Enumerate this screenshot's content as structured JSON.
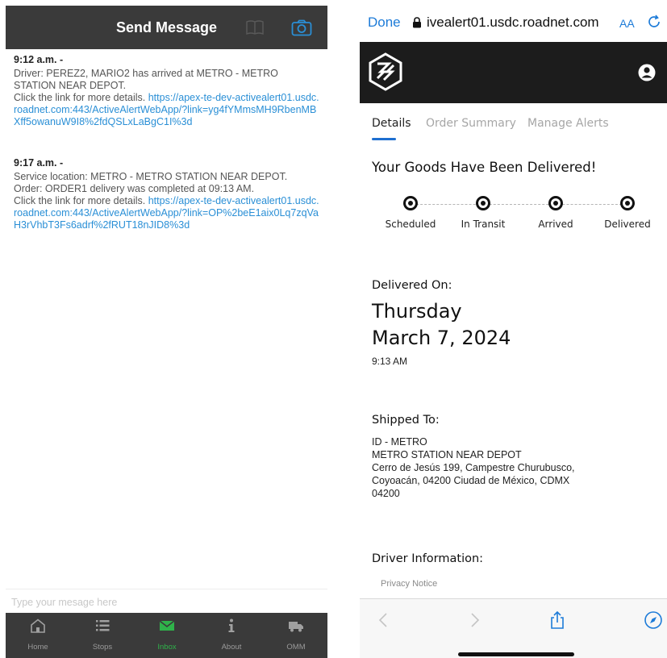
{
  "left_app": {
    "header": {
      "title": "Send Message",
      "book_icon": "book-icon",
      "camera_icon": "camera-icon"
    },
    "messages": [
      {
        "time": "9:12 a.m. -",
        "lines": [
          "Driver: PEREZ2, MARIO2   has arrived at METRO - METRO STATION NEAR DEPOT.",
          "Click the link for more details. "
        ],
        "link": "https://apex-te-dev-activealert01.usdc.roadnet.com:443/ActiveAlertWebApp/?link=yg4fYMmsMH9RbenMBXff5owanuW9I8%2fdQSLxLaBgC1I%3d"
      },
      {
        "time": "9:17 a.m. -",
        "lines": [
          "Service location: METRO - METRO STATION NEAR DEPOT.",
          "Order: ORDER1 delivery was completed at 09:13 AM.",
          "Click the link for more details. "
        ],
        "link": "https://apex-te-dev-activealert01.usdc.roadnet.com:443/ActiveAlertWebApp/?link=OP%2beE1aix0Lq7zqVaH3rVhbT3Fs6adrf%2fRUT18nJID8%3d"
      }
    ],
    "composer": {
      "placeholder": "Type your mesage here",
      "value": ""
    },
    "tabbar": [
      {
        "label": "Home",
        "icon": "home-icon",
        "active": false
      },
      {
        "label": "Stops",
        "icon": "list-icon",
        "active": false
      },
      {
        "label": "Inbox",
        "icon": "inbox-icon",
        "active": true
      },
      {
        "label": "About",
        "icon": "info-icon",
        "active": false
      },
      {
        "label": "OMM",
        "icon": "truck-icon",
        "active": false
      }
    ]
  },
  "right_app": {
    "browser": {
      "done_label": "Done",
      "url": "ivealert01.usdc.roadnet.com",
      "text_size_label": "AA",
      "lock_icon": "lock-icon",
      "reload_icon": "reload-icon"
    },
    "appbar": {
      "logo_icon": "logo-icon",
      "account_icon": "account-icon"
    },
    "tabs": [
      {
        "label": "Details",
        "active": true
      },
      {
        "label": "Order Summary",
        "active": false
      },
      {
        "label": "Manage Alerts",
        "active": false
      }
    ],
    "heading": "Your Goods Have Been Delivered!",
    "steps": [
      "Scheduled",
      "In Transit",
      "Arrived",
      "Delivered"
    ],
    "delivered_on": {
      "label": "Delivered On:",
      "day": "Thursday",
      "date": "March 7, 2024",
      "time": "9:13 AM"
    },
    "shipped_to": {
      "label": "Shipped To:",
      "lines": [
        "ID - METRO",
        "METRO STATION NEAR DEPOT",
        "Cerro de Jesús 199, Campestre Churubusco,",
        "Coyoacán, 04200 Ciudad de México, CDMX",
        "04200"
      ]
    },
    "driver_info": {
      "label": "Driver Information:",
      "privacy": "Privacy Notice"
    },
    "toolbar": [
      "back-icon",
      "forward-icon",
      "share-icon",
      "compass-icon"
    ],
    "colors": {
      "link": "#2a8fd6",
      "accent": "#1e6fd0",
      "active_tab": "#2fb34a",
      "dark_bar": "#3a3a3a"
    }
  }
}
